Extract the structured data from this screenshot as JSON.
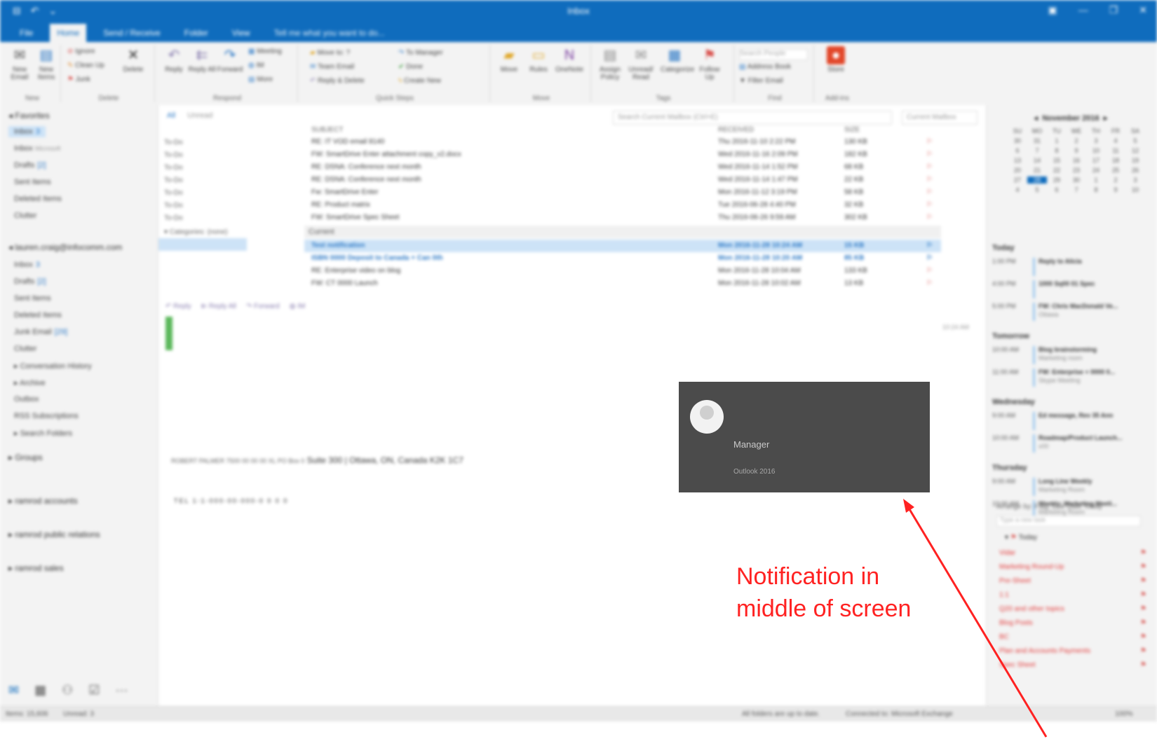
{
  "window": {
    "title": "Inbox",
    "quick_access": [
      "⊟",
      "↶",
      "⌄"
    ],
    "controls": [
      "▣",
      "—",
      "❐",
      "✕"
    ]
  },
  "tabs": [
    {
      "label": "File",
      "active": false
    },
    {
      "label": "Home",
      "active": true
    },
    {
      "label": "Send / Receive",
      "active": false
    },
    {
      "label": "Folder",
      "active": false
    },
    {
      "label": "View",
      "active": false
    },
    {
      "label": "Tell me what you want to do...",
      "active": false
    }
  ],
  "ribbon": {
    "new": {
      "new_email": "New Email",
      "new_items": "New Items",
      "label": "New"
    },
    "delete": {
      "ignore": "Ignore",
      "clean_up": "Clean Up",
      "junk": "Junk",
      "delete": "Delete",
      "label": "Delete"
    },
    "respond": {
      "reply": "Reply",
      "reply_all": "Reply All",
      "forward": "Forward",
      "meeting": "Meeting",
      "im": "IM",
      "more": "More",
      "label": "Respond"
    },
    "quick_steps": {
      "move_to": "Move to: ?",
      "team_email": "Team Email",
      "reply_delete": "Reply & Delete",
      "to_manager": "To Manager",
      "done": "Done",
      "create_new": "Create New",
      "label": "Quick Steps"
    },
    "move": {
      "move": "Move",
      "rules": "Rules",
      "onenote": "OneNote",
      "label": "Move"
    },
    "tags": {
      "assign_policy": "Assign Policy",
      "unread_read": "Unread/ Read",
      "categorize": "Categorize",
      "follow_up": "Follow Up",
      "label": "Tags"
    },
    "find": {
      "search_people": "Search People",
      "address_book": "Address Book",
      "filter_email": "Filter Email",
      "label": "Find"
    },
    "addins": {
      "store": "Store",
      "label": "Add-ins"
    }
  },
  "sidebar": {
    "favorites_header": "Favorites",
    "favorites": [
      {
        "label": "Inbox",
        "count": "3"
      },
      {
        "label": "Inbox",
        "count": "",
        "sub": "Microsoft"
      },
      {
        "label": "Drafts",
        "count": "[2]"
      },
      {
        "label": "Sent Items",
        "count": ""
      },
      {
        "label": "Deleted Items",
        "count": ""
      },
      {
        "label": "Clutter",
        "count": ""
      }
    ],
    "account_header": "lauren.craig@infocomm.com",
    "account_items": [
      {
        "label": "Inbox",
        "count": "3"
      },
      {
        "label": "Drafts",
        "count": "[2]"
      },
      {
        "label": "Sent Items",
        "count": ""
      },
      {
        "label": "Deleted Items",
        "count": ""
      },
      {
        "label": "Junk Email",
        "count": "[29]"
      },
      {
        "label": "Clutter",
        "count": ""
      },
      {
        "label": "Conversation History",
        "count": ""
      },
      {
        "label": "Archive",
        "count": ""
      },
      {
        "label": "Outbox",
        "count": ""
      },
      {
        "label": "RSS Subscriptions",
        "count": ""
      },
      {
        "label": "Search Folders",
        "count": ""
      }
    ],
    "groups_header": "Groups",
    "other_accounts": [
      "ramrod accounts",
      "ramrod public relations",
      "ramrod sales"
    ],
    "nav_icons": [
      "✉",
      "▦",
      "⚇",
      "☑",
      "···"
    ]
  },
  "mail": {
    "filters": [
      "All",
      "Unread"
    ],
    "search_placeholder": "Search Current Mailbox (Ctrl+E)",
    "search_scope": "Current Mailbox",
    "todo_labels": [
      "To-Do",
      "To-Do",
      "To-Do",
      "To-Do",
      "To-Do",
      "To-Do",
      "To-Do"
    ],
    "categories_label": "Categories: (none)",
    "columns": {
      "subject": "SUBJECT",
      "received": "RECEIVED",
      "size": "SIZE"
    },
    "rows_older": [
      {
        "subject": "RE: IT VOD email 8140",
        "received": "Thu 2016-11-10 2:22 PM",
        "size": "130 KB"
      },
      {
        "subject": "FW: SmartDrive Enter attachment copy_v2.docx",
        "received": "Wed 2016-11-16 2:09 PM",
        "size": "182 KB"
      },
      {
        "subject": "RE: DSNA: Conference next month",
        "received": "Wed 2016-11-14 1:52 PM",
        "size": "68 KB"
      },
      {
        "subject": "RE: DSNA: Conference next month",
        "received": "Wed 2016-11-14 1:47 PM",
        "size": "22 KB"
      },
      {
        "subject": "Fw: SmartDrive Enter",
        "received": "Mon 2016-11-12 3:19 PM",
        "size": "58 KB"
      },
      {
        "subject": "RE: Product matrix",
        "received": "Tue 2016-06-28 4:40 PM",
        "size": "32 KB"
      },
      {
        "subject": "FW: SmartDrive Spec Sheet",
        "received": "Thu 2016-06-26 9:59 AM",
        "size": "302 KB"
      }
    ],
    "group_current": "Current",
    "rows_current": [
      {
        "subject": "Test notification",
        "received": "Mon 2016-11-28 10:24 AM",
        "size": "15 KB",
        "selected": true,
        "unread": true
      },
      {
        "subject": "ISBN 0000 Deposit to Canada + Can 0th",
        "received": "Mon 2016-11-28 10:20 AM",
        "size": "85 KB",
        "selected": false,
        "unread": true
      },
      {
        "subject": "RE: Enterprise video on blog",
        "received": "Mon 2016-11-28 10:04 AM",
        "size": "133 KB",
        "selected": false,
        "unread": false
      },
      {
        "subject": "FW: CT 0000 Launch",
        "received": "Mon 2016-11-28 10:02 AM",
        "size": "13 KB",
        "selected": false,
        "unread": false
      }
    ],
    "reading_actions": [
      "Reply",
      "Reply All",
      "Forward",
      "IM"
    ],
    "reading_time": "10:24 AM",
    "address_small": "ROBERT PALMER  7500 00 00 00 XL  PO Box 0",
    "address_big": "Suite 300 | Ottawa, ON, Canada K2K 1C7",
    "phone": "TEL 1-1-000-00-000-0    0 0    0"
  },
  "calendar": {
    "month": "November 2016",
    "weekdays": [
      "SU",
      "MO",
      "TU",
      "WE",
      "TH",
      "FR",
      "SA"
    ],
    "days": [
      "30",
      "31",
      "1",
      "2",
      "3",
      "4",
      "5",
      "6",
      "7",
      "8",
      "9",
      "10",
      "11",
      "12",
      "13",
      "14",
      "15",
      "16",
      "17",
      "18",
      "19",
      "20",
      "21",
      "22",
      "23",
      "24",
      "25",
      "26",
      "27",
      "28",
      "29",
      "30",
      "1",
      "2",
      "3",
      "4",
      "5",
      "6",
      "7",
      "8",
      "9",
      "10"
    ],
    "today_index": 29
  },
  "agenda": [
    {
      "day": "Today",
      "items": [
        {
          "time": "1:00 PM",
          "subject": "Reply to Alicia",
          "location": ""
        },
        {
          "time": "4:00 PM",
          "subject": "1000 Sq00 01 Spec",
          "location": ""
        },
        {
          "time": "5:00 PM",
          "subject": "FW: Chris MacDonald Ve...",
          "location": "Ottawa"
        }
      ]
    },
    {
      "day": "Tomorrow",
      "items": [
        {
          "time": "10:00 AM",
          "subject": "Blog brainstorming",
          "location": "Marketing room"
        },
        {
          "time": "11:00 AM",
          "subject": "FW: Enterprise + 0000 0...",
          "location": "Skype Meeting"
        }
      ]
    },
    {
      "day": "Wednesday",
      "items": [
        {
          "time": "9:00 AM",
          "subject": "Ed message, Rev 35 Ann",
          "location": ""
        },
        {
          "time": "10:00 AM",
          "subject": "Roadmap/Product Launch...",
          "location": "x00"
        }
      ]
    },
    {
      "day": "Thursday",
      "items": [
        {
          "time": "9:00 AM",
          "subject": "Long Line Weekly",
          "location": "Marketing Room"
        },
        {
          "time": "10:00 AM",
          "subject": "Weekly: Marketing Meeti...",
          "location": "Marketing Room"
        }
      ]
    }
  ],
  "tasks": {
    "arrange": "Arrange by: Flag: Due Date  Today",
    "input_placeholder": "Type a new task",
    "today_label": "Today",
    "items": [
      "Vidar",
      "Marketing Round-Up",
      "Pre-Sheet",
      "1:1",
      "Q20 and other topics",
      "Blog Posts",
      "BC",
      "Plan and Accounts Payments",
      "Spec Sheet"
    ]
  },
  "statusbar": {
    "items": "Items: 15,606",
    "unread": "Unread: 3",
    "sync": "All folders are up to date.",
    "connection": "Connected to: Microsoft Exchange",
    "zoom": "100%"
  },
  "notification": {
    "sender": "Manager",
    "app": "Outlook 2016"
  },
  "annotation": {
    "line1": "Notification in",
    "line2": "middle of screen",
    "color": "#ff2222"
  }
}
